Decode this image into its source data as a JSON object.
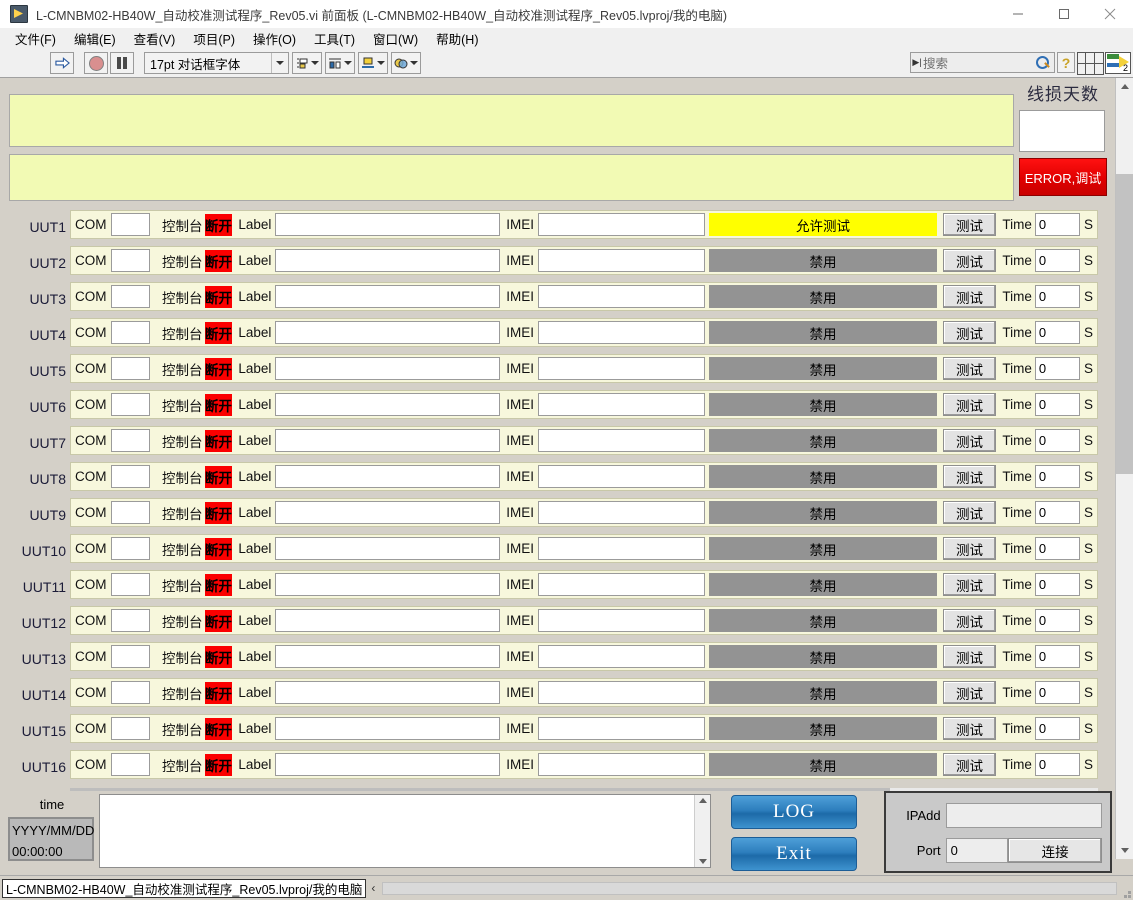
{
  "window": {
    "title": "L-CMNBM02-HB40W_自动校准测试程序_Rev05.vi 前面板 (L-CMNBM02-HB40W_自动校准测试程序_Rev05.lvproj/我的电脑)",
    "minimize": "—",
    "maximize": "□",
    "close": "✕"
  },
  "menu": {
    "items": [
      {
        "label": "文件(F)"
      },
      {
        "label": "编辑(E)"
      },
      {
        "label": "查看(V)"
      },
      {
        "label": "项目(P)"
      },
      {
        "label": "操作(O)"
      },
      {
        "label": "工具(T)"
      },
      {
        "label": "窗口(W)"
      },
      {
        "label": "帮助(H)"
      }
    ]
  },
  "toolbar": {
    "run_label": "",
    "abort_label": "",
    "pause_label": "",
    "font_value": "17pt 对话框字体",
    "align_label": "",
    "distribute_label": "",
    "resize_label": "",
    "reorder_label": "",
    "search_placeholder": "搜索",
    "help_label": "?",
    "vi_badge": "2"
  },
  "side": {
    "title": "线损天数",
    "indicator_value": "",
    "error_button": "ERROR,调试"
  },
  "banners": {
    "banner1_text": "",
    "banner2_text": ""
  },
  "row_labels": {
    "com": "COM",
    "console": "控制台",
    "disconnect": "断开",
    "label": "Label",
    "imei": "IMEI",
    "test": "测试",
    "time": "Time",
    "seconds": "S"
  },
  "rows": [
    {
      "name": "UUT1",
      "com": "",
      "label": "",
      "imei": "",
      "status": "允许测试",
      "enabled": true,
      "time": "0"
    },
    {
      "name": "UUT2",
      "com": "",
      "label": "",
      "imei": "",
      "status": "禁用",
      "enabled": false,
      "time": "0"
    },
    {
      "name": "UUT3",
      "com": "",
      "label": "",
      "imei": "",
      "status": "禁用",
      "enabled": false,
      "time": "0"
    },
    {
      "name": "UUT4",
      "com": "",
      "label": "",
      "imei": "",
      "status": "禁用",
      "enabled": false,
      "time": "0"
    },
    {
      "name": "UUT5",
      "com": "",
      "label": "",
      "imei": "",
      "status": "禁用",
      "enabled": false,
      "time": "0"
    },
    {
      "name": "UUT6",
      "com": "",
      "label": "",
      "imei": "",
      "status": "禁用",
      "enabled": false,
      "time": "0"
    },
    {
      "name": "UUT7",
      "com": "",
      "label": "",
      "imei": "",
      "status": "禁用",
      "enabled": false,
      "time": "0"
    },
    {
      "name": "UUT8",
      "com": "",
      "label": "",
      "imei": "",
      "status": "禁用",
      "enabled": false,
      "time": "0"
    },
    {
      "name": "UUT9",
      "com": "",
      "label": "",
      "imei": "",
      "status": "禁用",
      "enabled": false,
      "time": "0"
    },
    {
      "name": "UUT10",
      "com": "",
      "label": "",
      "imei": "",
      "status": "禁用",
      "enabled": false,
      "time": "0"
    },
    {
      "name": "UUT11",
      "com": "",
      "label": "",
      "imei": "",
      "status": "禁用",
      "enabled": false,
      "time": "0"
    },
    {
      "name": "UUT12",
      "com": "",
      "label": "",
      "imei": "",
      "status": "禁用",
      "enabled": false,
      "time": "0"
    },
    {
      "name": "UUT13",
      "com": "",
      "label": "",
      "imei": "",
      "status": "禁用",
      "enabled": false,
      "time": "0"
    },
    {
      "name": "UUT14",
      "com": "",
      "label": "",
      "imei": "",
      "status": "禁用",
      "enabled": false,
      "time": "0"
    },
    {
      "name": "UUT15",
      "com": "",
      "label": "",
      "imei": "",
      "status": "禁用",
      "enabled": false,
      "time": "0"
    },
    {
      "name": "UUT16",
      "com": "",
      "label": "",
      "imei": "",
      "status": "禁用",
      "enabled": false,
      "time": "0"
    }
  ],
  "bottom": {
    "time_label": "time",
    "time_value_line1": "YYYY/MM/DD",
    "time_value_line2": "00:00:00",
    "log_text": "",
    "log_button": "LOG",
    "exit_button": "Exit",
    "ipadd_label": "IPAdd",
    "ipadd_value": "",
    "port_label": "Port",
    "port_value": "0",
    "connect_button": "连接"
  },
  "statusbar": {
    "path": "L-CMNBM02-HB40W_自动校准测试程序_Rev05.lvproj/我的电脑",
    "chevron": "‹"
  },
  "colors": {
    "enabled_bar": "#ffff00",
    "disabled_bar": "#939393",
    "disconnect": "#fb0000",
    "error": "#e00000",
    "banner": "#f2fab4",
    "row_strip": "#f7f7dc",
    "accent_blue": "#2d7ebd"
  }
}
